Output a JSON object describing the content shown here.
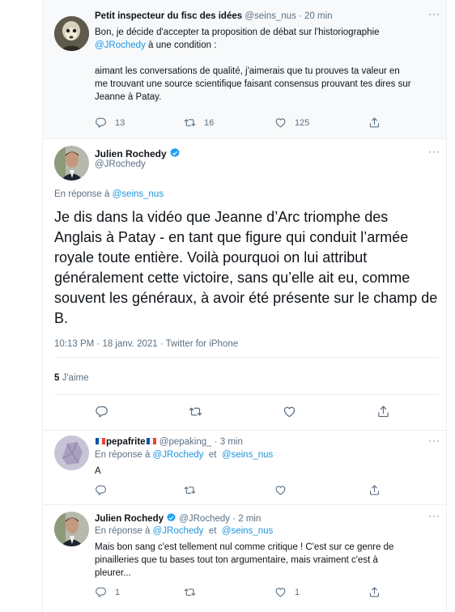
{
  "tweet1": {
    "name": "Petit inspecteur du fisc des idées",
    "handle": "@seins_nus",
    "time": "· 20 min",
    "line1": "Bon, je décide d'accepter ta proposition de débat sur l'historiographie",
    "line2_mention": "@JRochedy",
    "line2_rest": " à une condition :",
    "para1": "aimant les conversations de qualité, j'aimerais que tu prouves ta valeur en",
    "para2": "me trouvant une source scientifique faisant consensus prouvant tes dires sur",
    "para3": "Jeanne à Patay.",
    "replies": "13",
    "retweets": "16",
    "likes": "125"
  },
  "main": {
    "name": "Julien Rochedy",
    "handle": "@JRochedy",
    "reply_prefix": "En réponse à",
    "reply_to": "@seins_nus",
    "text": "Je dis dans la vidéo que Jeanne d’Arc triomphe des Anglais à Patay - en tant que figure qui conduit l’armée royale toute entière. Voilà pourquoi on lui attribut généralement cette victoire, sans qu’elle ait eu, comme souvent les généraux, à avoir été présente sur le champ de B.",
    "meta": "10:13 PM · 18 janv. 2021 · Twitter for iPhone",
    "likes_count": "5",
    "likes_label": "J'aime"
  },
  "reply1": {
    "name": "pepafrite",
    "handle": "@pepaking_",
    "time": "· 3 min",
    "reply_prefix": "En réponse à",
    "mention1": "@JRochedy",
    "et": "et",
    "mention2": "@seins_nus",
    "text": "A"
  },
  "reply2": {
    "name": "Julien Rochedy",
    "handle": "@JRochedy",
    "time": "· 2 min",
    "reply_prefix": "En réponse à",
    "mention1": "@JRochedy",
    "et": "et",
    "mention2": "@seins_nus",
    "line1": "Mais bon sang c'est tellement nul comme critique ! C'est sur ce genre de",
    "line2": "pinailleries que tu bases tout ton argumentaire, mais vraiment c'est à",
    "line3": "pleurer...",
    "replies": "1",
    "retweets": "",
    "likes": "1"
  },
  "colors": {
    "accent": "#1b95e0",
    "muted": "#5b7083",
    "verified": "#1da1f2",
    "border": "#ebeef0",
    "highlight_bg": "#f7f9fa"
  },
  "icons": [
    "reply-icon",
    "retweet-icon",
    "like-icon",
    "share-icon",
    "more-icon",
    "verified-icon"
  ]
}
